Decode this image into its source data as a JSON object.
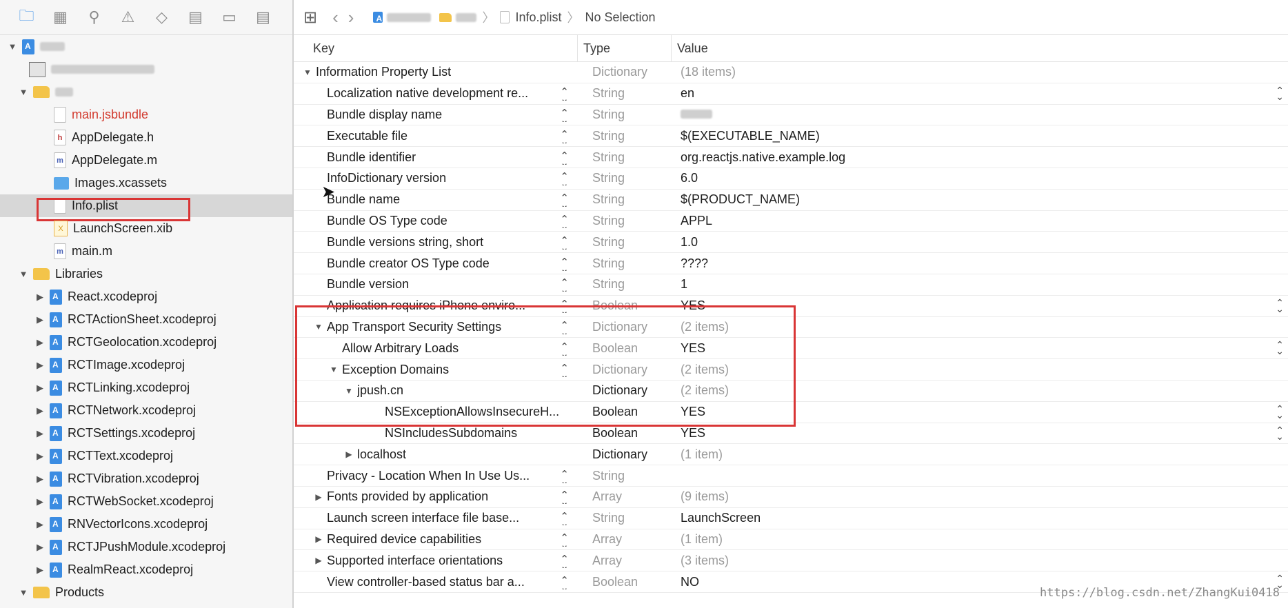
{
  "navigator": {
    "toolbar_icons": [
      "folder-icon",
      "hierarchy-icon",
      "search-icon",
      "warning-icon",
      "test-diamond-icon",
      "debug-grid-icon",
      "breakpoint-icon",
      "report-icon"
    ],
    "items": [
      {
        "level": 0,
        "disclosure": "open",
        "icon": "project-icon",
        "label": "",
        "blurred": true
      },
      {
        "level": 1,
        "disclosure": "none",
        "icon": "config-icon",
        "label": "",
        "blurred": true
      },
      {
        "level": 1,
        "disclosure": "open",
        "icon": "folder-icon",
        "label": "",
        "blurred": true
      },
      {
        "level": 2,
        "disclosure": "none",
        "icon": "js-file-icon",
        "label": "main.jsbundle",
        "red": true
      },
      {
        "level": 2,
        "disclosure": "none",
        "icon": "header-file-icon",
        "label": "AppDelegate.h"
      },
      {
        "level": 2,
        "disclosure": "none",
        "icon": "m-file-icon",
        "label": "AppDelegate.m"
      },
      {
        "level": 2,
        "disclosure": "none",
        "icon": "assets-icon",
        "label": "Images.xcassets"
      },
      {
        "level": 2,
        "disclosure": "none",
        "icon": "plist-icon",
        "label": "Info.plist",
        "selected": true
      },
      {
        "level": 2,
        "disclosure": "none",
        "icon": "xib-icon",
        "label": "LaunchScreen.xib"
      },
      {
        "level": 2,
        "disclosure": "none",
        "icon": "m-file-icon",
        "label": "main.m"
      },
      {
        "level": 1,
        "disclosure": "open",
        "icon": "folder-icon",
        "label": "Libraries"
      },
      {
        "level": 2,
        "disclosure": "closed",
        "icon": "project-icon",
        "label": "React.xcodeproj"
      },
      {
        "level": 2,
        "disclosure": "closed",
        "icon": "project-icon",
        "label": "RCTActionSheet.xcodeproj"
      },
      {
        "level": 2,
        "disclosure": "closed",
        "icon": "project-icon",
        "label": "RCTGeolocation.xcodeproj"
      },
      {
        "level": 2,
        "disclosure": "closed",
        "icon": "project-icon",
        "label": "RCTImage.xcodeproj"
      },
      {
        "level": 2,
        "disclosure": "closed",
        "icon": "project-icon",
        "label": "RCTLinking.xcodeproj"
      },
      {
        "level": 2,
        "disclosure": "closed",
        "icon": "project-icon",
        "label": "RCTNetwork.xcodeproj"
      },
      {
        "level": 2,
        "disclosure": "closed",
        "icon": "project-icon",
        "label": "RCTSettings.xcodeproj"
      },
      {
        "level": 2,
        "disclosure": "closed",
        "icon": "project-icon",
        "label": "RCTText.xcodeproj"
      },
      {
        "level": 2,
        "disclosure": "closed",
        "icon": "project-icon",
        "label": "RCTVibration.xcodeproj"
      },
      {
        "level": 2,
        "disclosure": "closed",
        "icon": "project-icon",
        "label": "RCTWebSocket.xcodeproj"
      },
      {
        "level": 2,
        "disclosure": "closed",
        "icon": "project-icon",
        "label": "RNVectorIcons.xcodeproj"
      },
      {
        "level": 2,
        "disclosure": "closed",
        "icon": "project-icon",
        "label": "RCTJPushModule.xcodeproj"
      },
      {
        "level": 2,
        "disclosure": "closed",
        "icon": "project-icon",
        "label": "RealmReact.xcodeproj"
      },
      {
        "level": 1,
        "disclosure": "open",
        "icon": "folder-icon",
        "label": "Products"
      }
    ]
  },
  "jumpbar": {
    "file": "Info.plist",
    "selection": "No Selection"
  },
  "plist": {
    "headers": {
      "key": "Key",
      "type": "Type",
      "value": "Value"
    },
    "rows": [
      {
        "level": 0,
        "disclosure": "open",
        "key": "Information Property List",
        "type": "Dictionary",
        "value": "(18 items)",
        "type_dark": false,
        "value_gray": true
      },
      {
        "level": 1,
        "key": "Localization native development re...",
        "type": "String",
        "value": "en",
        "stepper": true,
        "rstep": true
      },
      {
        "level": 1,
        "key": "Bundle display name",
        "type": "String",
        "value": "",
        "stepper": true,
        "blur_value": true
      },
      {
        "level": 1,
        "key": "Executable file",
        "type": "String",
        "value": "$(EXECUTABLE_NAME)",
        "stepper": true
      },
      {
        "level": 1,
        "key": "Bundle identifier",
        "type": "String",
        "value": "org.reactjs.native.example.log",
        "stepper": true
      },
      {
        "level": 1,
        "key": "InfoDictionary version",
        "type": "String",
        "value": "6.0",
        "stepper": true
      },
      {
        "level": 1,
        "key": "Bundle name",
        "type": "String",
        "value": "$(PRODUCT_NAME)",
        "stepper": true
      },
      {
        "level": 1,
        "key": "Bundle OS Type code",
        "type": "String",
        "value": "APPL",
        "stepper": true
      },
      {
        "level": 1,
        "key": "Bundle versions string, short",
        "type": "String",
        "value": "1.0",
        "stepper": true
      },
      {
        "level": 1,
        "key": "Bundle creator OS Type code",
        "type": "String",
        "value": "????",
        "stepper": true
      },
      {
        "level": 1,
        "key": "Bundle version",
        "type": "String",
        "value": "1",
        "stepper": true
      },
      {
        "level": 1,
        "key": "Application requires iPhone enviro...",
        "type": "Boolean",
        "value": "YES",
        "stepper": true,
        "rstep": true
      },
      {
        "level": 1,
        "disclosure": "open",
        "key": "App Transport Security Settings",
        "type": "Dictionary",
        "value": "(2 items)",
        "value_gray": true,
        "stepper": true
      },
      {
        "level": 2,
        "key": "Allow Arbitrary Loads",
        "type": "Boolean",
        "value": "YES",
        "stepper": true,
        "rstep": true
      },
      {
        "level": 2,
        "disclosure": "open",
        "key": "Exception Domains",
        "type": "Dictionary",
        "value": "(2 items)",
        "value_gray": true,
        "stepper": true
      },
      {
        "level": 3,
        "disclosure": "open",
        "key": "jpush.cn",
        "type": "Dictionary",
        "value": "(2 items)",
        "type_dark": true,
        "value_gray": true
      },
      {
        "level": 4,
        "key": "NSExceptionAllowsInsecureH...",
        "type": "Boolean",
        "value": "YES",
        "type_dark": true,
        "rstep": true
      },
      {
        "level": 4,
        "key": "NSIncludesSubdomains",
        "type": "Boolean",
        "value": "YES",
        "type_dark": true,
        "rstep": true
      },
      {
        "level": 3,
        "disclosure": "closed",
        "key": "localhost",
        "type": "Dictionary",
        "value": "(1 item)",
        "type_dark": true,
        "value_gray": true
      },
      {
        "level": 1,
        "key": "Privacy - Location When In Use Us...",
        "type": "String",
        "value": "",
        "stepper": true
      },
      {
        "level": 1,
        "disclosure": "closed",
        "key": "Fonts provided by application",
        "type": "Array",
        "value": "(9 items)",
        "value_gray": true,
        "stepper": true
      },
      {
        "level": 1,
        "key": "Launch screen interface file base...",
        "type": "String",
        "value": "LaunchScreen",
        "stepper": true
      },
      {
        "level": 1,
        "disclosure": "closed",
        "key": "Required device capabilities",
        "type": "Array",
        "value": "(1 item)",
        "value_gray": true,
        "stepper": true
      },
      {
        "level": 1,
        "disclosure": "closed",
        "key": "Supported interface orientations",
        "type": "Array",
        "value": "(3 items)",
        "value_gray": true,
        "stepper": true
      },
      {
        "level": 1,
        "key": "View controller-based status bar a...",
        "type": "Boolean",
        "value": "NO",
        "stepper": true,
        "rstep": true
      }
    ]
  },
  "watermark": "https://blog.csdn.net/ZhangKui0418",
  "colors": {
    "highlight_box": "#d93535",
    "accent": "#3a8ee6",
    "red_file": "#d23a2e"
  }
}
